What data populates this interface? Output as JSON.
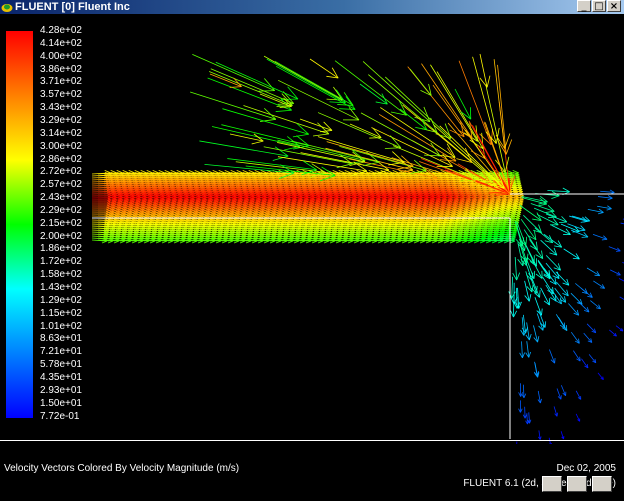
{
  "window": {
    "title": "FLUENT [0] Fluent Inc",
    "minimize_glyph": "_",
    "maximize_glyph": "□",
    "close_glyph": "×"
  },
  "colorbar": {
    "labels": [
      "4.28e+02",
      "4.14e+02",
      "4.00e+02",
      "3.86e+02",
      "3.71e+02",
      "3.57e+02",
      "3.43e+02",
      "3.29e+02",
      "3.14e+02",
      "3.00e+02",
      "2.86e+02",
      "2.72e+02",
      "2.57e+02",
      "2.43e+02",
      "2.29e+02",
      "2.15e+02",
      "2.00e+02",
      "1.86e+02",
      "1.72e+02",
      "1.58e+02",
      "1.43e+02",
      "1.29e+02",
      "1.15e+02",
      "1.01e+02",
      "8.63e+01",
      "7.21e+01",
      "5.78e+01",
      "4.35e+01",
      "2.93e+01",
      "1.50e+01",
      "7.72e-01"
    ],
    "colors": [
      "#ff0000",
      "#ff1a00",
      "#ff3300",
      "#ff4d00",
      "#ff6600",
      "#ff8000",
      "#ff9900",
      "#ffb300",
      "#ffcc00",
      "#ffe600",
      "#ffff00",
      "#ccff00",
      "#99ff00",
      "#66ff00",
      "#33ff00",
      "#00ff00",
      "#00ff33",
      "#00ff66",
      "#00ff99",
      "#00ffcc",
      "#00ffff",
      "#00e6ff",
      "#00ccff",
      "#00b3ff",
      "#0099ff",
      "#0080ff",
      "#0066ff",
      "#004dff",
      "#0033ff",
      "#001aff",
      "#0000ff"
    ]
  },
  "caption": {
    "description": "Velocity Vectors Colored By Velocity Magnitude (m/s)",
    "date": "Dec 02, 2005",
    "version": "FLUENT 6.1 (2d, segregated, ske)"
  }
}
